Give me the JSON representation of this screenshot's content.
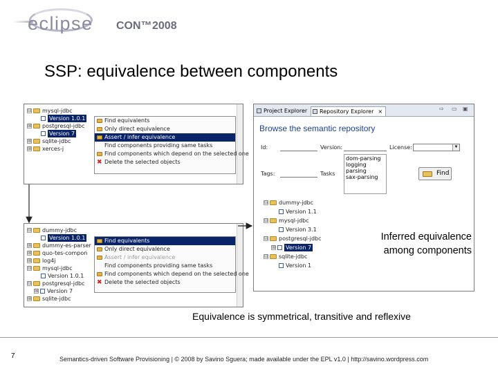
{
  "logo": {
    "word": "eclipse",
    "con": "CON™",
    "year": "2008"
  },
  "slide": {
    "title": "SSP: equivalence between components",
    "inferred_caption_line1": "Inferred equivalence",
    "inferred_caption_line2": "among components",
    "subtitle": "Equivalence is symmetrical, transitive and reflexive",
    "page_number": "7",
    "footer": "Semantics-driven Software Provisioning | © 2008 by Savino Sguera; made available under the EPL v1.0 | http://savino.wordpress.com"
  },
  "tree_top": {
    "nodes": [
      "mysql-jdbc",
      "Version 1.0.1",
      "postgresql-jdbc",
      "Version 7",
      "sqlite-jdbc",
      "xerces-j"
    ],
    "expanders": [
      "⊟",
      "⊞",
      "⊞",
      "⊞"
    ]
  },
  "menu_top": {
    "items": [
      "Find equivalents",
      "Only direct equivalence",
      "Assert / infer equivalence",
      "Find components providing same tasks",
      "Find components which depend on the selected one",
      "Delete the selected objects"
    ]
  },
  "tree_bottom": {
    "nodes": [
      "dummy-jdbc",
      "Version 1.0.1",
      "dummy-es-parser",
      "quo-tes-compon",
      "log4j",
      "mysql-jdbc",
      "Version 1.0.1",
      "postgresql-jdbc",
      "Version 7",
      "sqlite-jdbc"
    ],
    "expanders": [
      "⊟",
      "⊞",
      "⊞",
      "⊞",
      "⊞",
      "⊟",
      "⊟",
      "⊞",
      "⊞"
    ]
  },
  "menu_bottom": {
    "items": [
      "Find equivalents",
      "Only direct equivalence",
      "Assert / infer equivalence",
      "Find components providing same tasks",
      "Find components which depend on the selected one",
      "Delete the selected objects"
    ]
  },
  "repo": {
    "tabs": [
      "Project Explorer",
      "Repository Explorer"
    ],
    "close": "×",
    "heading": "Browse the semantic repository",
    "labels": {
      "id": "Id:",
      "version": "Version:",
      "license": "License:",
      "tags": "Tags:",
      "tasks": "Tasks"
    },
    "tasks": [
      "dom-parsing",
      "logging",
      "parsing",
      "sax-parsing"
    ],
    "find_button": "Find",
    "tree": [
      "dummy-jdbc",
      "Version 1.1",
      "mysql-jdbc",
      "Version 3.1",
      "postgresql-jdbc",
      "Version 7",
      "sqlite-jdbc",
      "Version 1"
    ],
    "tree_expanders": [
      "⊟",
      "⊟",
      "⊟",
      "⊞",
      "⊟"
    ]
  }
}
